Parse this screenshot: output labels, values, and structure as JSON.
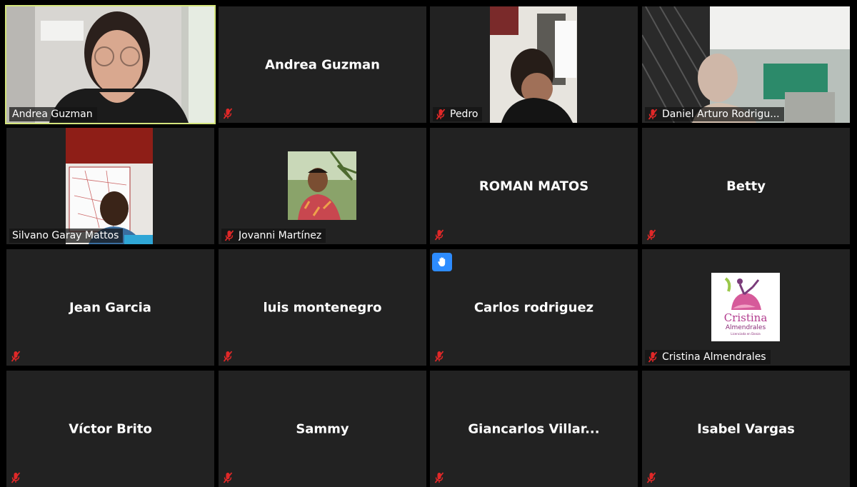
{
  "participants": [
    {
      "name": "Andrea Guzman",
      "row": 0,
      "col": 0,
      "kind": "video-woman",
      "active": true,
      "muted": false
    },
    {
      "name": "Andrea Guzman",
      "row": 0,
      "col": 1,
      "kind": "name",
      "muted": true
    },
    {
      "name": "Pedro",
      "row": 0,
      "col": 2,
      "kind": "video-pedro",
      "muted": true
    },
    {
      "name": "Daniel Arturo Rodrigu...",
      "row": 0,
      "col": 3,
      "kind": "video-daniel",
      "muted": true
    },
    {
      "name": "Silvano Garay Mattos",
      "row": 1,
      "col": 0,
      "kind": "video-silvano",
      "muted": false
    },
    {
      "name": "Jovanni Martínez",
      "row": 1,
      "col": 1,
      "kind": "photo-jovanni",
      "muted": true
    },
    {
      "name": "ROMAN MATOS",
      "row": 1,
      "col": 2,
      "kind": "name",
      "muted": true
    },
    {
      "name": "Betty",
      "row": 1,
      "col": 3,
      "kind": "name",
      "muted": true
    },
    {
      "name": "Jean Garcia",
      "row": 2,
      "col": 0,
      "kind": "name",
      "muted": true
    },
    {
      "name": "luis montenegro",
      "row": 2,
      "col": 1,
      "kind": "name",
      "muted": true
    },
    {
      "name": "Carlos rodriguez",
      "row": 2,
      "col": 2,
      "kind": "name",
      "muted": true,
      "hand_raised": true
    },
    {
      "name": "Cristina Almendrales",
      "row": 2,
      "col": 3,
      "kind": "logo",
      "muted": true
    },
    {
      "name": "Víctor Brito",
      "row": 3,
      "col": 0,
      "kind": "name",
      "muted": true
    },
    {
      "name": "Sammy",
      "row": 3,
      "col": 1,
      "kind": "name",
      "muted": true
    },
    {
      "name": "Giancarlos  Villar...",
      "row": 3,
      "col": 2,
      "kind": "name",
      "muted": true
    },
    {
      "name": "Isabel Vargas",
      "row": 3,
      "col": 3,
      "kind": "name",
      "muted": true
    }
  ],
  "logo": {
    "line1": "Cristina",
    "line2": "Almendrales",
    "line3": "Licenciada en Danza"
  },
  "colors": {
    "tile_bg": "#222222",
    "active_border": "#d4e57c",
    "muted_icon": "#e02828",
    "hand_bg": "#2d8cff"
  },
  "icons": {
    "muted": "mic-muted-icon",
    "hand": "raised-hand-icon"
  }
}
